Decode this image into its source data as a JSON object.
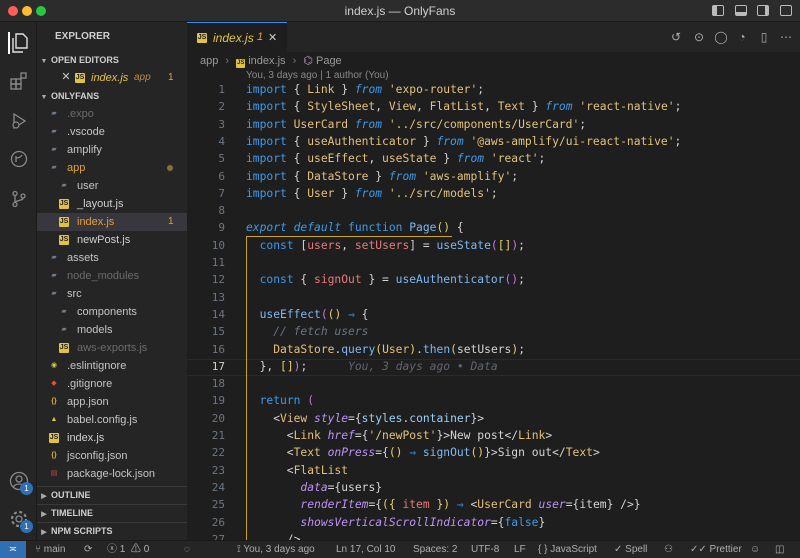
{
  "window": {
    "title": "index.js — OnlyFans"
  },
  "activity": {
    "badge_accounts": "1",
    "badge_settings": "1"
  },
  "explorer": {
    "header": "EXPLORER",
    "open_editors_label": "OPEN EDITORS",
    "open_file": {
      "name": "index.js",
      "folder": "app",
      "count": "1"
    },
    "project_label": "ONLYFANS",
    "tree": [
      {
        "name": ".expo",
        "type": "folder",
        "dim": true
      },
      {
        "name": ".vscode",
        "type": "folder"
      },
      {
        "name": "amplify",
        "type": "folder"
      },
      {
        "name": "app",
        "type": "folder",
        "modified": true
      },
      {
        "name": "user",
        "type": "folder"
      },
      {
        "name": "_layout.js",
        "type": "js"
      },
      {
        "name": "index.js",
        "type": "js",
        "count": "1"
      },
      {
        "name": "newPost.js",
        "type": "js"
      },
      {
        "name": "assets",
        "type": "folder"
      },
      {
        "name": "node_modules",
        "type": "folder",
        "dim": true
      },
      {
        "name": "src",
        "type": "folder"
      },
      {
        "name": "components",
        "type": "folder"
      },
      {
        "name": "models",
        "type": "folder"
      },
      {
        "name": "aws-exports.js",
        "type": "js",
        "dim": true
      },
      {
        "name": ".eslintignore",
        "type": "eslint"
      },
      {
        "name": ".gitignore",
        "type": "git"
      },
      {
        "name": "app.json",
        "type": "json"
      },
      {
        "name": "babel.config.js",
        "type": "babel"
      },
      {
        "name": "index.js",
        "type": "js"
      },
      {
        "name": "jsconfig.json",
        "type": "json"
      },
      {
        "name": "package-lock.json",
        "type": "lock"
      }
    ],
    "outline_label": "OUTLINE",
    "timeline_label": "TIMELINE",
    "npm_label": "NPM SCRIPTS"
  },
  "editor": {
    "tab": {
      "name": "index.js",
      "count": "1"
    },
    "breadcrumb": [
      "app",
      "index.js",
      "Page"
    ],
    "codelens": "You, 3 days ago | 1 author (You)",
    "current_line_hint": "You, 3 days ago • Data",
    "lines": [
      [
        [
          "k",
          "import"
        ],
        [
          "p",
          " { "
        ],
        [
          "v",
          "Link"
        ],
        [
          "p",
          " } "
        ],
        [
          "ki",
          "from"
        ],
        [
          "s",
          " 'expo-router'"
        ],
        [
          "p",
          ";"
        ]
      ],
      [
        [
          "k",
          "import"
        ],
        [
          "p",
          " { "
        ],
        [
          "v",
          "StyleSheet"
        ],
        [
          "p",
          ", "
        ],
        [
          "v",
          "View"
        ],
        [
          "p",
          ", "
        ],
        [
          "v",
          "FlatList"
        ],
        [
          "p",
          ", "
        ],
        [
          "v",
          "Text"
        ],
        [
          "p",
          " } "
        ],
        [
          "ki",
          "from"
        ],
        [
          "s",
          " 'react-native'"
        ],
        [
          "p",
          ";"
        ]
      ],
      [
        [
          "k",
          "import"
        ],
        [
          "v",
          " UserCard"
        ],
        [
          "ki",
          " from"
        ],
        [
          "s",
          " '../src/components/UserCard'"
        ],
        [
          "p",
          ";"
        ]
      ],
      [
        [
          "k",
          "import"
        ],
        [
          "p",
          " { "
        ],
        [
          "v",
          "useAuthenticator"
        ],
        [
          "p",
          " } "
        ],
        [
          "ki",
          "from"
        ],
        [
          "s",
          " '@aws-amplify/ui-react-native'"
        ],
        [
          "p",
          ";"
        ]
      ],
      [
        [
          "k",
          "import"
        ],
        [
          "p",
          " { "
        ],
        [
          "v",
          "useEffect"
        ],
        [
          "p",
          ", "
        ],
        [
          "v",
          "useState"
        ],
        [
          "p",
          " } "
        ],
        [
          "ki",
          "from"
        ],
        [
          "s",
          " 'react'"
        ],
        [
          "p",
          ";"
        ]
      ],
      [
        [
          "k",
          "import"
        ],
        [
          "p",
          " { "
        ],
        [
          "v",
          "DataStore"
        ],
        [
          "p",
          " } "
        ],
        [
          "ki",
          "from"
        ],
        [
          "s",
          " 'aws-amplify'"
        ],
        [
          "p",
          ";"
        ]
      ],
      [
        [
          "k",
          "import"
        ],
        [
          "p",
          " { "
        ],
        [
          "v",
          "User"
        ],
        [
          "p",
          " } "
        ],
        [
          "ki",
          "from"
        ],
        [
          "s",
          " '../src/models'"
        ],
        [
          "p",
          ";"
        ]
      ],
      [],
      [
        [
          "ki",
          "export"
        ],
        [
          "ki",
          " default"
        ],
        [
          "k",
          " function"
        ],
        [
          "f",
          " Page"
        ],
        [
          "y",
          "()"
        ],
        [
          "p",
          " {"
        ]
      ],
      [
        [
          "p",
          "  "
        ],
        [
          "k",
          "const"
        ],
        [
          "p",
          " ["
        ],
        [
          "t",
          "users"
        ],
        [
          "p",
          ", "
        ],
        [
          "t",
          "setUsers"
        ],
        [
          "p",
          "] = "
        ],
        [
          "f",
          "useState"
        ],
        [
          "m",
          "("
        ],
        [
          "y",
          "[]"
        ],
        [
          "m",
          ")"
        ],
        [
          "p",
          ";"
        ]
      ],
      [],
      [
        [
          "p",
          "  "
        ],
        [
          "k",
          "const"
        ],
        [
          "p",
          " { "
        ],
        [
          "t",
          "signOut"
        ],
        [
          "p",
          " } = "
        ],
        [
          "f",
          "useAuthenticator"
        ],
        [
          "m",
          "()"
        ],
        [
          "p",
          ";"
        ]
      ],
      [],
      [
        [
          "p",
          "  "
        ],
        [
          "f",
          "useEffect"
        ],
        [
          "m",
          "("
        ],
        [
          "y",
          "()"
        ],
        [
          "p",
          " "
        ],
        [
          "k",
          "⇒"
        ],
        [
          "p",
          " {"
        ]
      ],
      [
        [
          "c",
          "    // fetch users"
        ]
      ],
      [
        [
          "p",
          "    "
        ],
        [
          "v",
          "DataStore"
        ],
        [
          "p",
          "."
        ],
        [
          "f",
          "query"
        ],
        [
          "y",
          "("
        ],
        [
          "v",
          "User"
        ],
        [
          "y",
          ")"
        ],
        [
          "p",
          "."
        ],
        [
          "f",
          "then"
        ],
        [
          "y",
          "("
        ],
        [
          "p",
          "setUsers"
        ],
        [
          "y",
          ")"
        ],
        [
          "p",
          ";"
        ]
      ],
      [
        [
          "p",
          "  }, "
        ],
        [
          "y",
          "[]"
        ],
        [
          "m",
          ")"
        ],
        [
          "p",
          ";"
        ]
      ],
      [],
      [
        [
          "p",
          "  "
        ],
        [
          "k",
          "return"
        ],
        [
          "m",
          " ("
        ]
      ],
      [
        [
          "p",
          "    <"
        ],
        [
          "v",
          "View"
        ],
        [
          "a",
          " style"
        ],
        [
          "p",
          "={"
        ],
        [
          "n",
          "styles"
        ],
        [
          "p",
          "."
        ],
        [
          "n",
          "container"
        ],
        [
          "p",
          "}>"
        ]
      ],
      [
        [
          "p",
          "      <"
        ],
        [
          "v",
          "Link"
        ],
        [
          "a",
          " href"
        ],
        [
          "p",
          "={"
        ],
        [
          "s",
          "'/newPost'"
        ],
        [
          "p",
          "}>New post</"
        ],
        [
          "v",
          "Link"
        ],
        [
          "p",
          ">"
        ]
      ],
      [
        [
          "p",
          "      <"
        ],
        [
          "v",
          "Text"
        ],
        [
          "a",
          " onPress"
        ],
        [
          "p",
          "={"
        ],
        [
          "y",
          "()"
        ],
        [
          "k",
          " ⇒ "
        ],
        [
          "f",
          "signOut"
        ],
        [
          "y",
          "()"
        ],
        [
          "p",
          "}>Sign out</"
        ],
        [
          "v",
          "Text"
        ],
        [
          "p",
          ">"
        ]
      ],
      [
        [
          "p",
          "      <"
        ],
        [
          "v",
          "FlatList"
        ]
      ],
      [
        [
          "a",
          "        data"
        ],
        [
          "p",
          "={"
        ],
        [
          "p",
          "users"
        ],
        [
          "p",
          "}"
        ]
      ],
      [
        [
          "a",
          "        renderItem"
        ],
        [
          "p",
          "={"
        ],
        [
          "y",
          "({ "
        ],
        [
          "t",
          "item"
        ],
        [
          "y",
          " })"
        ],
        [
          "k",
          " ⇒ "
        ],
        [
          "p",
          "<"
        ],
        [
          "v",
          "UserCard"
        ],
        [
          "a",
          " user"
        ],
        [
          "p",
          "={"
        ],
        [
          "p",
          "item"
        ],
        [
          "p",
          "} />}"
        ]
      ],
      [
        [
          "a",
          "        showsVerticalScrollIndicator"
        ],
        [
          "p",
          "={"
        ],
        [
          "k",
          "false"
        ],
        [
          "p",
          "}"
        ]
      ],
      [
        [
          "p",
          "      />"
        ]
      ]
    ]
  },
  "statusbar": {
    "branch": "main",
    "errors": "1",
    "warnings": "0",
    "blame": "You, 3 days ago",
    "position": "Ln 17, Col 10",
    "spaces": "Spaces: 2",
    "encoding": "UTF-8",
    "eol": "LF",
    "language": "JavaScript",
    "spell": "Spell",
    "prettier": "Prettier"
  }
}
